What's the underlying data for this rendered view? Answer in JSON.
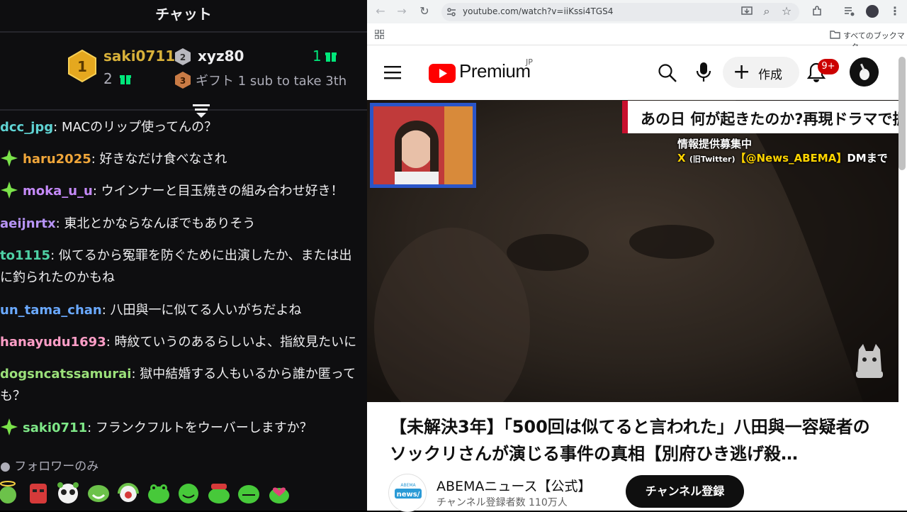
{
  "chat": {
    "title": "チャット",
    "leaderboard": [
      {
        "rank": 1,
        "user": "saki0711",
        "gifts": "2",
        "color": "#d8b13a"
      },
      {
        "rank": 2,
        "user": "xyz80",
        "gifts": "1",
        "color": "#efeff1"
      },
      {
        "rank": 3,
        "text": "ギフト 1 sub to take 3th"
      }
    ],
    "messages": [
      {
        "user": "dcc_jpg",
        "sep": ": ",
        "text": "MACのリップ使ってんの？",
        "color": "#5fd3d3",
        "badge": false
      },
      {
        "user": "haru2025",
        "sep": ": ",
        "text": "好きなだけ食べなされ",
        "color": "#f0a63a",
        "badge": true
      },
      {
        "user": "moka_u_u",
        "sep": ": ",
        "text": "ウインナーと目玉焼きの組み合わせ好き！",
        "color": "#c58af9",
        "badge": true
      },
      {
        "user": "aeijnrtx",
        "sep": ": ",
        "text": "東北とかならなんぼでもありそう",
        "color": "#b794f6",
        "badge": false
      },
      {
        "user": "to1115",
        "sep": ": ",
        "text": "似てるから冤罪を防ぐために出演したか、または出",
        "color": "#4fd1a5",
        "badge": false
      },
      {
        "user": "",
        "sep": "",
        "text": "に釣られたのかもね",
        "color": "#efeff1",
        "badge": false
      },
      {
        "user": "un_tama_chan",
        "sep": ": ",
        "text": "八田與一に似てる人いがちだよね",
        "color": "#6aa9ff",
        "badge": false
      },
      {
        "user": "hanayudu1693",
        "sep": ": ",
        "text": "時紋ていうのあるらしいよ、指紋見たいに",
        "color": "#ff9ec7",
        "badge": false
      },
      {
        "user": "dogsncatssamurai",
        "sep": ": ",
        "text": "獄中結婚する人もいるから誰か匿って",
        "color": "#9be07a",
        "badge": false
      },
      {
        "user": "",
        "sep": "",
        "text": "も？",
        "color": "#efeff1",
        "badge": false
      },
      {
        "user": "saki0711",
        "sep": ": ",
        "text": "フランクフルトをウーバーしますか？",
        "color": "#7ee787",
        "badge": true
      }
    ],
    "followers_only": "フォロワーのみ",
    "emotes": [
      "halo-emote",
      "angry-emote",
      "panda-emote",
      "smile-emote",
      "headphone-emote",
      "frog-emote",
      "frog-happy-emote",
      "frog-hat-emote",
      "frog-grin-emote",
      "frog-heart-emote"
    ]
  },
  "browser": {
    "url": "youtube.com/watch?v=iiKssi4TGS4",
    "bookmarks_label": "すべてのブックマーク"
  },
  "youtube": {
    "brand": "Premium",
    "region": "JP",
    "create_label": "作成",
    "notif_count": "9+",
    "video": {
      "caption_top": "あの日 何が起きたのか?再現ドラマで振り返る",
      "caption_info1": "情報提供募集中",
      "caption_info2_prefix": "X",
      "caption_info2_small": "(旧Twitter)",
      "caption_info2_handle": "【@News_ABEMA】",
      "caption_info2_suffix": "DMまで"
    },
    "title": "【未解決3年】「500回は似てると言われた」八田與一容疑者のソックリさんが演じる事件の真相【別府ひき逃げ殺…",
    "channel": {
      "name": "ABEMAニュース【公式】",
      "subscribers": "チャンネル登録者数 110万人",
      "logo_text": "ABEMA news/"
    },
    "subscribe_label": "チャンネル登録"
  }
}
